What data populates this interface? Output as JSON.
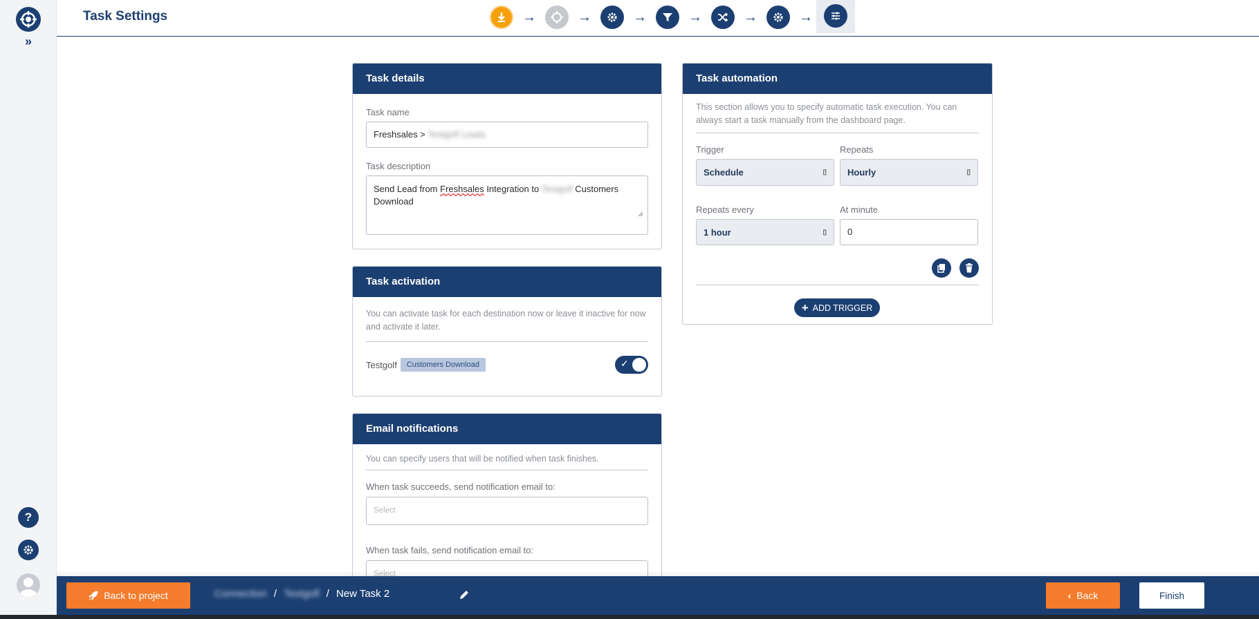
{
  "header": {
    "title": "Task Settings"
  },
  "steps": [
    "download-step",
    "connector-step",
    "settings-step",
    "filter-step",
    "shuffle-step",
    "settings-step-2",
    "task-settings-step"
  ],
  "task_details": {
    "heading": "Task details",
    "name_label": "Task name",
    "name_prefix": "Freshsales >",
    "name_blurred": "Testgolf Leads",
    "description_label": "Task description",
    "description_part1": "Send Lead from ",
    "description_link": "Freshsales",
    "description_part2": " Integration to ",
    "description_blurred": "Testgolf",
    "description_part3": " Customers Download"
  },
  "task_activation": {
    "heading": "Task activation",
    "info": "You can activate task for each destination now or leave it inactive for now and activate it later.",
    "destination": "Testgolf",
    "badge": "Customers Download",
    "active": true
  },
  "email_notifications": {
    "heading": "Email notifications",
    "info": "You can specify users that will be notified when task finishes.",
    "success_label": "When task succeeds, send notification email to:",
    "success_placeholder": "Select",
    "fail_label": "When task fails, send notification email to:",
    "fail_placeholder": "Select"
  },
  "task_automation": {
    "heading": "Task automation",
    "info": "This section allows you to specify automatic task execution. You can always start a task manually from the dashboard page.",
    "trigger_label": "Trigger",
    "trigger_value": "Schedule",
    "repeats_label": "Repeats",
    "repeats_value": "Hourly",
    "repeats_every_label": "Repeats every",
    "repeats_every_value": "1 hour",
    "at_minute_label": "At minute",
    "at_minute_value": "0",
    "add_trigger": "ADD TRIGGER"
  },
  "footer": {
    "back_to_project": "Back to project",
    "crumb1": "Connection",
    "crumb2": "Testgolf",
    "crumb3": "New Task 2",
    "separator": "/",
    "back": "Back",
    "finish": "Finish"
  },
  "colors": {
    "primary": "#1c3f72",
    "accent": "#f47c2c",
    "step_orange": "#f6a00b"
  }
}
